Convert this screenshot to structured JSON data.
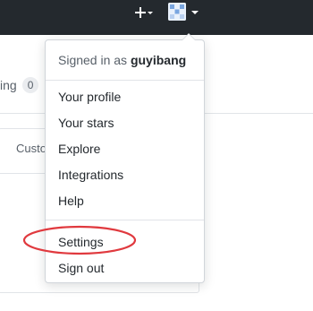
{
  "header": {
    "create_icon": "plus-icon",
    "avatar_icon": "identicon-avatar"
  },
  "background": {
    "partial_label": "ing",
    "counter": "0",
    "partial_tab": "Custo"
  },
  "dropdown": {
    "signed_in_prefix": "Signed in as",
    "username": "guyibang",
    "items": [
      {
        "label": "Your profile"
      },
      {
        "label": "Your stars"
      },
      {
        "label": "Explore"
      },
      {
        "label": "Integrations"
      },
      {
        "label": "Help"
      },
      {
        "label": "Settings"
      },
      {
        "label": "Sign out"
      }
    ]
  },
  "colors": {
    "header_bg": "#24292e",
    "highlight_ring": "#e0393e"
  }
}
